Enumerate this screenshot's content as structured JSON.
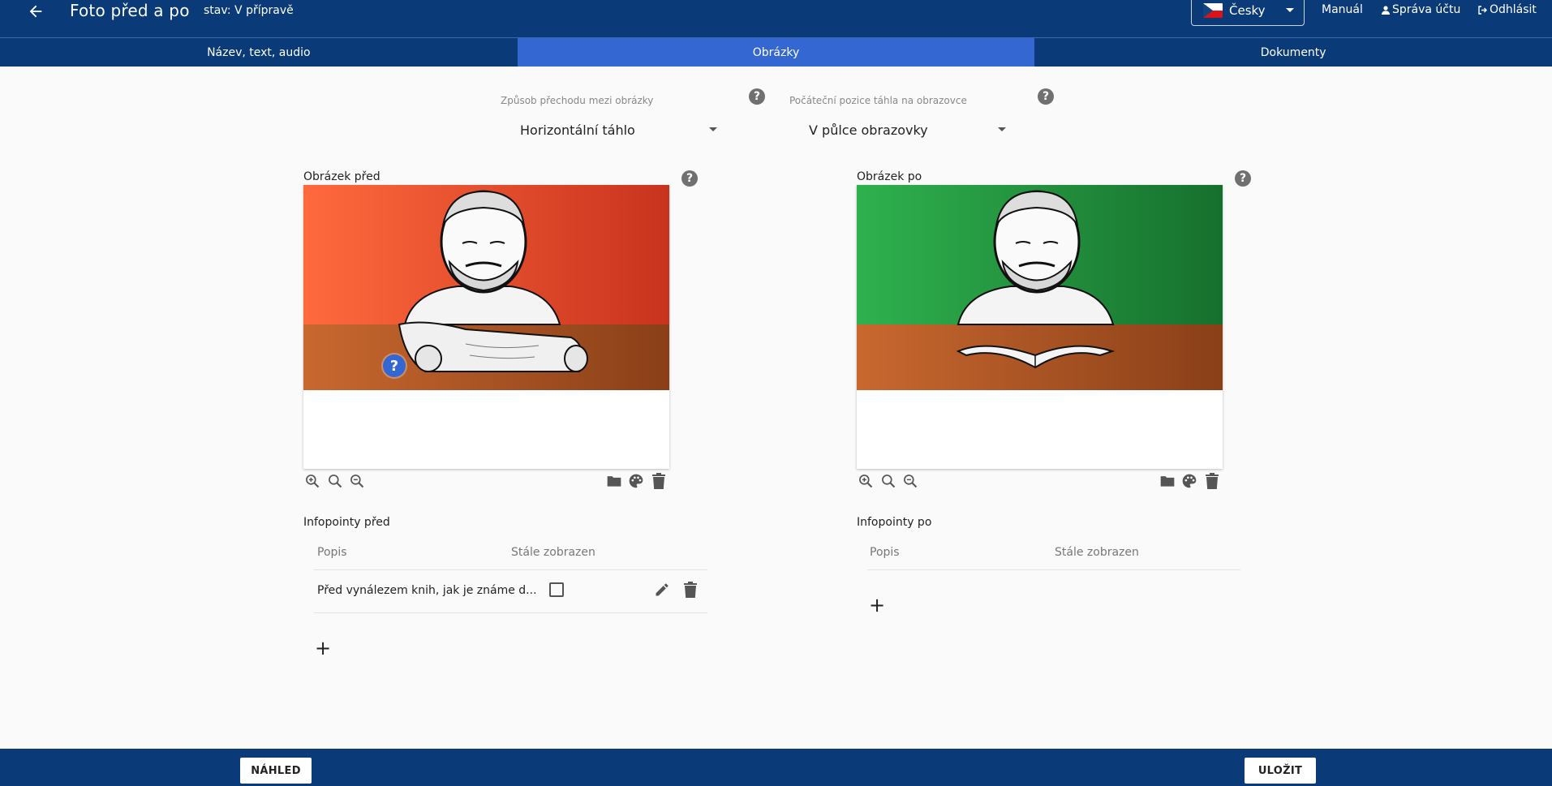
{
  "header": {
    "title": "Foto před a po",
    "status": "stav: V přípravě",
    "language": "Česky",
    "manual": "Manuál",
    "account": "Správa účtu",
    "logout": "Odhlásit"
  },
  "tabs": [
    {
      "label": "Název, text, audio",
      "active": false
    },
    {
      "label": "Obrázky",
      "active": true
    },
    {
      "label": "Dokumenty",
      "active": false
    }
  ],
  "settings": {
    "transition_label": "Způsob přechodu mezi obrázky",
    "transition_value": "Horizontální táhlo",
    "position_label": "Počáteční pozice táhla na obrazovce",
    "position_value": "V půlce obrazovky"
  },
  "before": {
    "title": "Obrázek před",
    "infopoints_title": "Infopointy před",
    "col_desc": "Popis",
    "col_always": "Stále zobrazen",
    "rows": [
      {
        "text": "Před vynálezem knih, jak je známe d...",
        "always_shown": false
      }
    ]
  },
  "after": {
    "title": "Obrázek po",
    "infopoints_title": "Infopointy po",
    "col_desc": "Popis",
    "col_always": "Stále zobrazen",
    "rows": []
  },
  "footer": {
    "preview": "NÁHLED",
    "save": "ULOŽIT"
  },
  "colors": {
    "header_bg": "#0a3a78",
    "tab_active": "#3467d1",
    "before_bg": "#f2683e",
    "after_bg": "#2aa14a"
  }
}
